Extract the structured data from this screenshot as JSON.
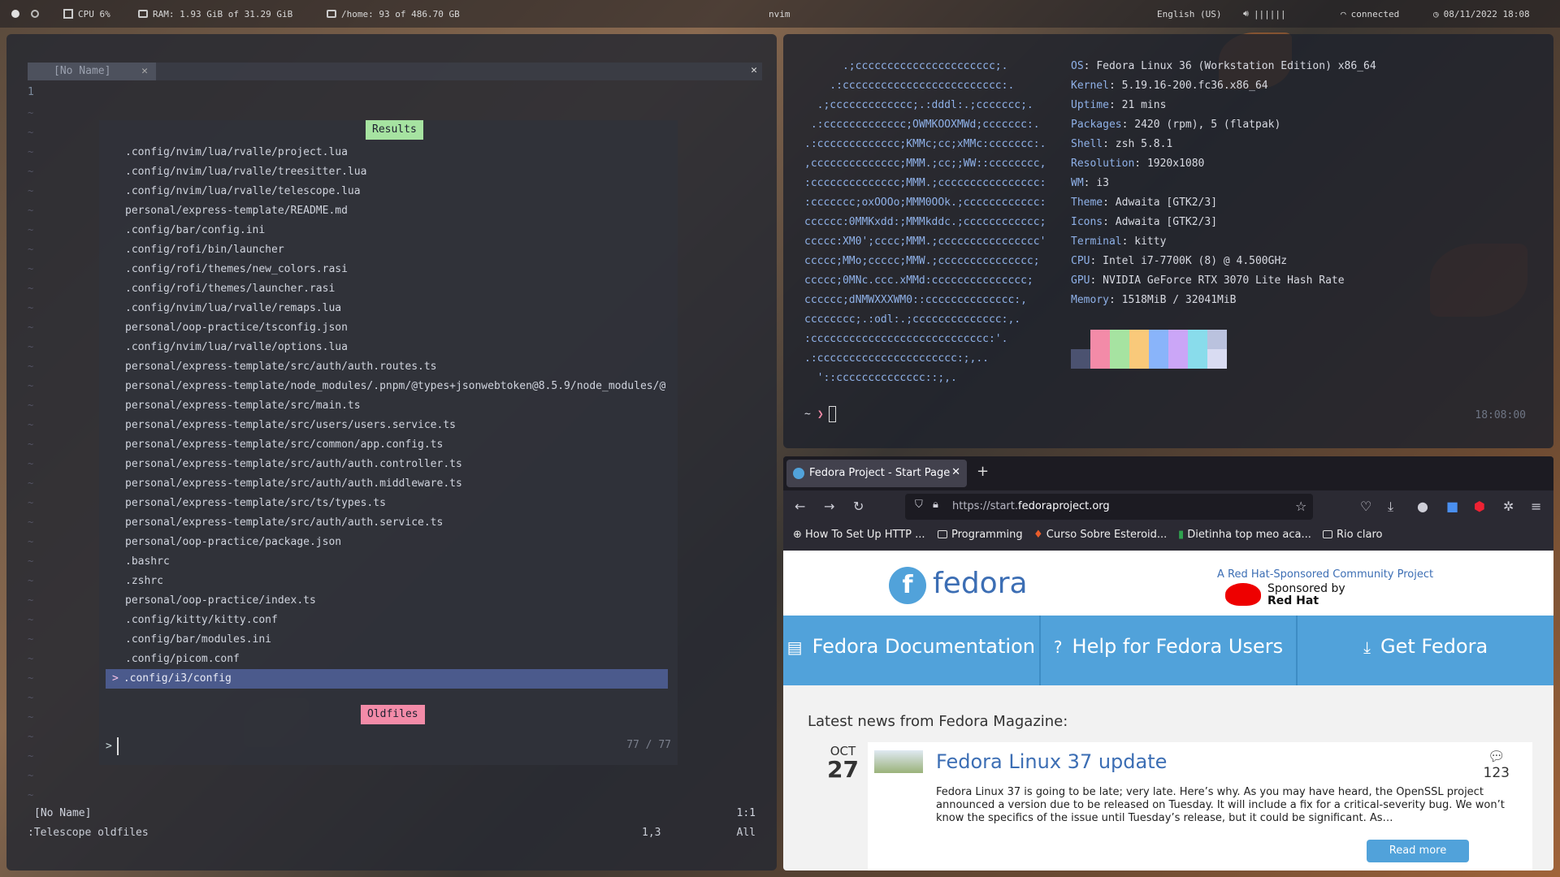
{
  "topbar": {
    "cpu": "CPU 6%",
    "ram": "RAM: 1.93 GiB of 31.29 GiB",
    "home": "/home: 93 of 486.70 GB",
    "window_title": "nvim",
    "keyboard": "English (US)",
    "volume": "||||||",
    "wifi": "connected",
    "datetime": "08/11/2022 18:08"
  },
  "nvim": {
    "tab_label": "[No Name]",
    "line_number": "1",
    "telescope": {
      "results_title": "Results",
      "results": [
        ".config/nvim/lua/rvalle/project.lua",
        ".config/nvim/lua/rvalle/treesitter.lua",
        ".config/nvim/lua/rvalle/telescope.lua",
        "personal/express-template/README.md",
        ".config/bar/config.ini",
        ".config/rofi/bin/launcher",
        ".config/rofi/themes/new_colors.rasi",
        ".config/rofi/themes/launcher.rasi",
        ".config/nvim/lua/rvalle/remaps.lua",
        "personal/oop-practice/tsconfig.json",
        ".config/nvim/lua/rvalle/options.lua",
        "personal/express-template/src/auth/auth.routes.ts",
        "personal/express-template/node_modules/.pnpm/@types+jsonwebtoken@8.5.9/node_modules/@",
        "personal/express-template/src/main.ts",
        "personal/express-template/src/users/users.service.ts",
        "personal/express-template/src/common/app.config.ts",
        "personal/express-template/src/auth/auth.controller.ts",
        "personal/express-template/src/auth/auth.middleware.ts",
        "personal/express-template/src/ts/types.ts",
        "personal/express-template/src/auth/auth.service.ts",
        "personal/oop-practice/package.json",
        ".bashrc",
        ".zshrc",
        "personal/oop-practice/index.ts",
        ".config/kitty/kitty.conf",
        ".config/bar/modules.ini",
        ".config/picom.conf"
      ],
      "selected": ".config/i3/config",
      "selected_caret": ">",
      "prompt_title": "Oldfiles",
      "prompt_char": ">",
      "count": "77 / 77"
    },
    "status_file": "[No Name]",
    "status_pos": "1:1",
    "command": ":Telescope oldfiles",
    "cmd_pos": "1,3",
    "cmd_all": "All"
  },
  "terminal": {
    "ascii": [
      "      .;cccccccccccccccccccccc;.",
      "    .:ccccccccccccccccccccccccc:.",
      "  .;ccccccccccccc;.:dddl:.;ccccccc;.",
      " .:ccccccccccccc;OWMKOOXMWd;ccccccc:.",
      ".:ccccccccccccc;KMMc;cc;xMMc:ccccccc:.",
      ",cccccccccccccc;MMM.;cc;;WW::cccccccc,",
      ":cccccccccccccc;MMM.;cccccccccccccccc:",
      ":ccccccc;oxOOOo;MMM0OOk.;cccccccccccc:",
      "cccccc:0MMKxdd:;MMMkddc.;cccccccccccc;",
      "ccccc:XM0';cccc;MMM.;cccccccccccccccc'",
      "ccccc;MMo;ccccc;MMW.;ccccccccccccccc;",
      "ccccc;0MNc.ccc.xMMd:ccccccccccccccc;",
      "cccccc;dNMWXXXWM0::cccccccccccccc:,",
      "cccccccc;.:odl:.;cccccccccccccc:,.",
      ":cccccccccccccccccccccccccccc:'.",
      ".:cccccccccccccccccccccc:;,..",
      "  '::cccccccccccccc::;,."
    ],
    "info": [
      {
        "key": "OS",
        "value": "Fedora Linux 36 (Workstation Edition) x86_64"
      },
      {
        "key": "Kernel",
        "value": "5.19.16-200.fc36.x86_64"
      },
      {
        "key": "Uptime",
        "value": "21 mins"
      },
      {
        "key": "Packages",
        "value": "2420 (rpm), 5 (flatpak)"
      },
      {
        "key": "Shell",
        "value": "zsh 5.8.1"
      },
      {
        "key": "Resolution",
        "value": "1920x1080"
      },
      {
        "key": "WM",
        "value": "i3"
      },
      {
        "key": "Theme",
        "value": "Adwaita [GTK2/3]"
      },
      {
        "key": "Icons",
        "value": "Adwaita [GTK2/3]"
      },
      {
        "key": "Terminal",
        "value": "kitty"
      },
      {
        "key": "CPU",
        "value": "Intel i7-7700K (8) @ 4.500GHz"
      },
      {
        "key": "GPU",
        "value": "NVIDIA GeForce RTX 3070 Lite Hash Rate"
      },
      {
        "key": "Memory",
        "value": "1518MiB / 32041MiB"
      }
    ],
    "palette": [
      "#4b5270",
      "#f38ba8",
      "#a6e3a1",
      "#f9c97a",
      "#89b4fa",
      "#cba6f7",
      "#89dceb",
      "#bac2de"
    ],
    "prompt_tilde": "~",
    "prompt_arrow": "❯",
    "clock": "18:08:00"
  },
  "firefox": {
    "tab_title": "Fedora Project - Start Page",
    "url_prefix": "https://start.",
    "url_domain": "fedoraproject.org",
    "bookmarks": [
      "How To Set Up HTTP ...",
      "Programming",
      "Curso Sobre Esteroid...",
      "Dietinha top meo aca...",
      "Rio claro"
    ],
    "page": {
      "logo_word": "fedora",
      "tagline": "A Red Hat-Sponsored Community Project",
      "sponsored": "Sponsored by",
      "redhat": "Red Hat",
      "nav": [
        "Fedora Documentation",
        "Help for Fedora Users",
        "Get Fedora"
      ],
      "news_heading": "Latest news from Fedora Magazine:",
      "article": {
        "month": "OCT",
        "day": "27",
        "title": "Fedora Linux 37 update",
        "comments": "123",
        "excerpt": "Fedora Linux 37 is going to be late; very late. Here’s why. As you may have heard, the OpenSSL project announced a version due to be released on Tuesday. It will include a fix for a critical-severity bug. We won’t know the specifics of the issue until Tuesday’s release, but it could be significant. As…",
        "read_more": "Read more"
      }
    }
  }
}
